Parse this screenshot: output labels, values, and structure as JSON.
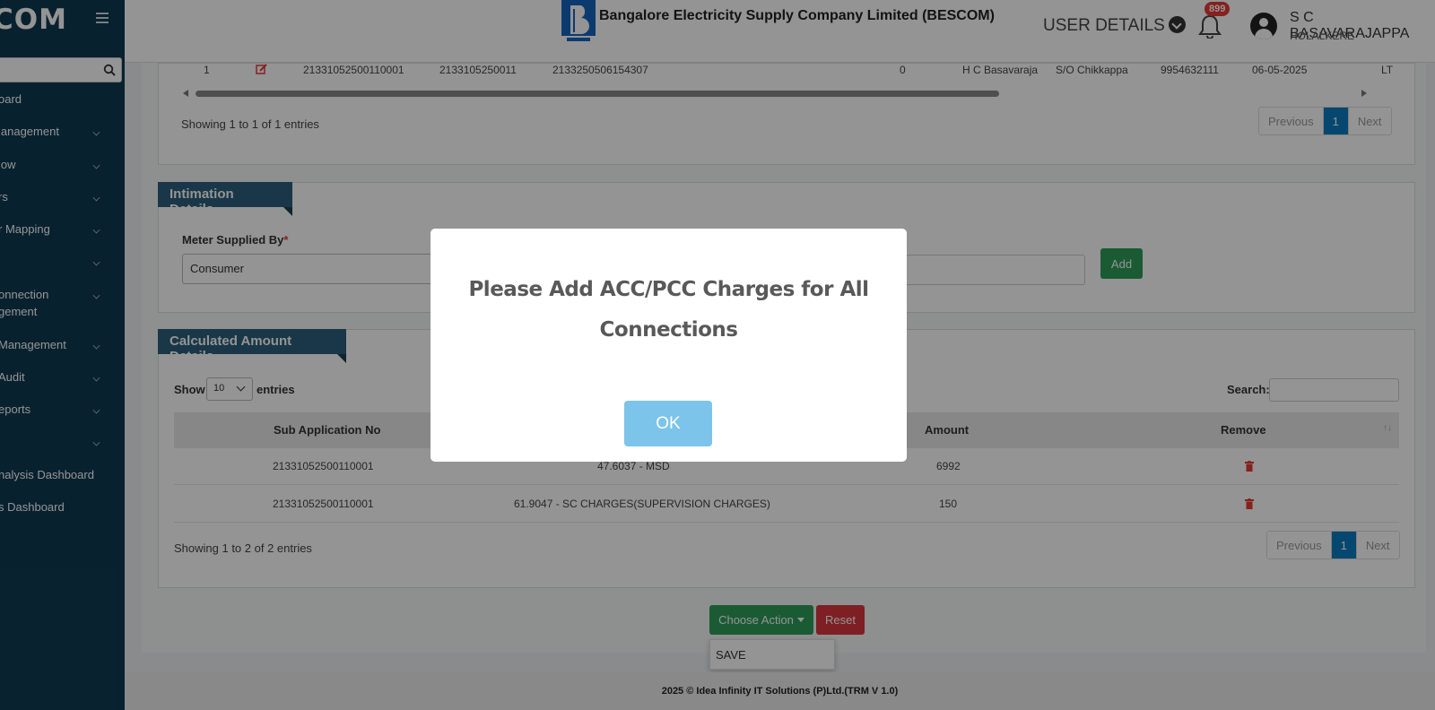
{
  "sidebar": {
    "brand": "COM",
    "items": [
      {
        "label": "oard",
        "chevron": false
      },
      {
        "label": "lanagement",
        "chevron": true
      },
      {
        "label": "low",
        "chevron": true
      },
      {
        "label": "rs",
        "chevron": true
      },
      {
        "label": "r Mapping",
        "chevron": true
      },
      {
        "label": "",
        "chevron": true
      },
      {
        "label": "onnection",
        "label2": "gement",
        "chevron": true
      },
      {
        "label": "Management",
        "chevron": true
      },
      {
        "label": "Audit",
        "chevron": true
      },
      {
        "label": "eports",
        "chevron": true
      },
      {
        "label": "",
        "chevron": true
      },
      {
        "label": "nalysis Dashboard",
        "chevron": false
      },
      {
        "label": "s Dashboard",
        "chevron": false
      }
    ]
  },
  "header": {
    "company": "Bangalore Electricity Supply Company Limited (BESCOM)",
    "user_details_label": "USER DETAILS",
    "notification_count": "899",
    "user_name": "S C BASAVARAJAPPA",
    "user_location": "HOLALKERE"
  },
  "connection_table": {
    "row": {
      "sl": "1",
      "sub_app_no": "21331052500110001",
      "account_id": "2133105250011",
      "app_no": "2133250506154307",
      "value": "0",
      "name": "H C Basavaraja",
      "relation": "S/O Chikkappa",
      "phone": "9954632111",
      "date": "06-05-2025",
      "type": "LT"
    },
    "info": "Showing 1 to 1 of 1 entries",
    "pager": {
      "previous": "Previous",
      "page": "1",
      "next": "Next"
    }
  },
  "intimation": {
    "title": "Intimation Details",
    "meter_label": "Meter Supplied By",
    "required_mark": "*",
    "meter_value": "Consumer",
    "add_label": "Add"
  },
  "calculated": {
    "title": "Calculated Amount Details",
    "show_label": "Show",
    "entries_value": "10",
    "entries_label": "entries",
    "search_label": "Search:",
    "columns": {
      "sub_app_no": "Sub Application No",
      "amount": "Amount",
      "remove": "Remove"
    },
    "rows": [
      {
        "sub_app_no": "21331052500110001",
        "charge": "47.6037 - MSD",
        "amount": "6992"
      },
      {
        "sub_app_no": "21331052500110001",
        "charge": "61.9047 - SC CHARGES(SUPERVISION CHARGES)",
        "amount": "150"
      }
    ],
    "info": "Showing 1 to 2 of 2 entries",
    "pager": {
      "previous": "Previous",
      "page": "1",
      "next": "Next"
    }
  },
  "actions": {
    "choose_action": "Choose Action",
    "reset": "Reset",
    "menu_save": "SAVE"
  },
  "footer": "2025 © Idea Infinity IT Solutions (P)Ltd.(TRM V 1.0)",
  "modal": {
    "message": "Please Add ACC/PCC Charges for All Connections",
    "ok": "OK"
  },
  "colors": {
    "sidebar": "#0f3a52",
    "ribbon": "#2c5f7c",
    "primary": "#0b7bc1",
    "success": "#2e9e5b",
    "danger": "#d9363e",
    "ok_button": "#7cc4e9"
  }
}
